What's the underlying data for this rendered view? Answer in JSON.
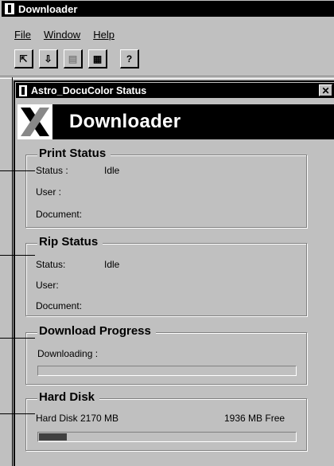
{
  "app": {
    "title": "Downloader"
  },
  "menu": {
    "file": "File",
    "window": "Window",
    "help": "Help"
  },
  "toolbar": {
    "btn1": "⇱",
    "btn2": "⇩",
    "btn3": "▤",
    "btn4": "▦",
    "btn5": "?"
  },
  "child": {
    "title": "Astro_DocuColor Status",
    "close": "✕"
  },
  "banner": {
    "text": "Downloader"
  },
  "print_status": {
    "title": "Print Status",
    "status_label": "Status :",
    "status_value": "Idle",
    "user_label": "User :",
    "document_label": "Document:"
  },
  "rip_status": {
    "title": "Rip Status",
    "status_label": "Status:",
    "status_value": "Idle",
    "user_label": "User:",
    "document_label": "Document:"
  },
  "download_progress": {
    "title": "Download Progress",
    "label": "Downloading :",
    "progress": 0
  },
  "hard_disk": {
    "title": "Hard Disk",
    "total": "Hard Disk 2170 MB",
    "free": "1936 MB Free",
    "used_fraction": 0.11
  }
}
